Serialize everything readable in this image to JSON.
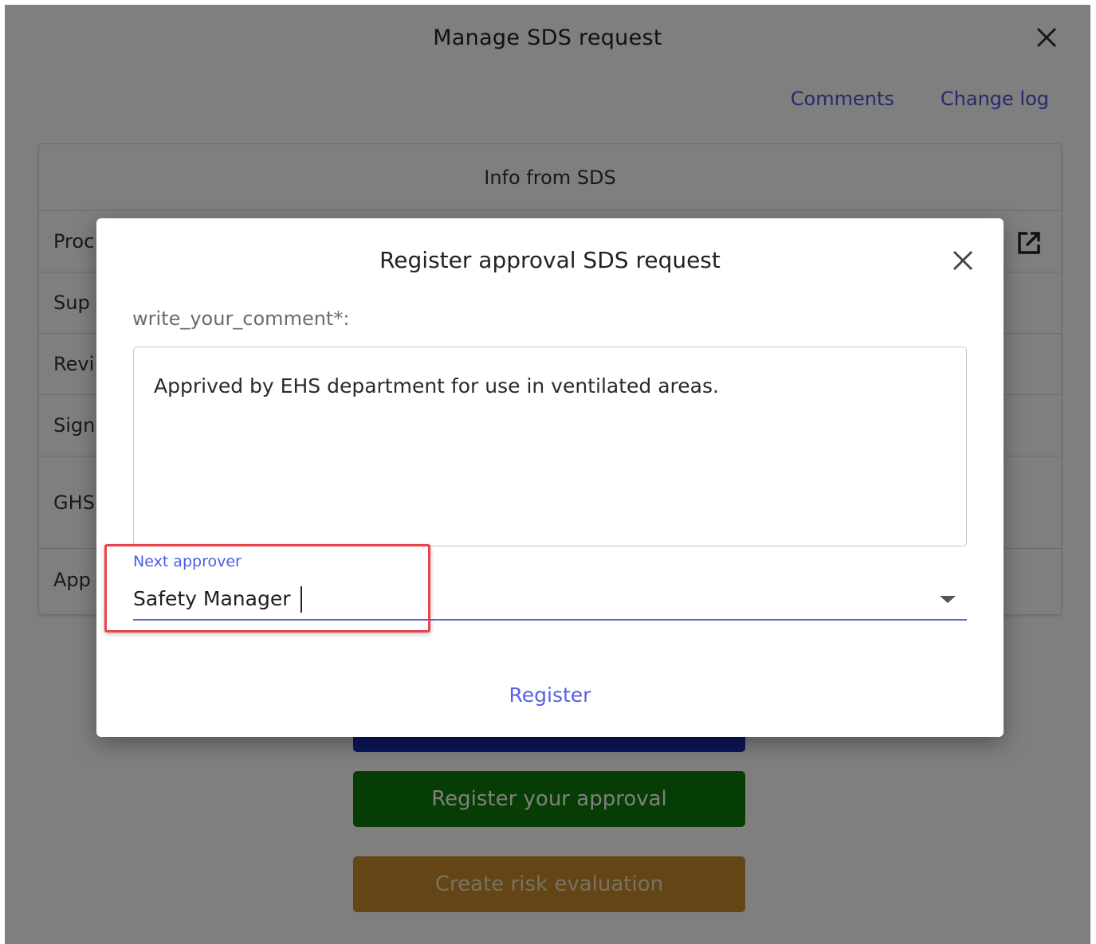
{
  "background": {
    "title": "Manage SDS request",
    "links": {
      "comments": "Comments",
      "change_log": "Change log"
    },
    "info_card": {
      "heading": "Info from SDS",
      "rows": [
        "Proc",
        "Sup",
        "Revi",
        "Sign",
        "GHS",
        "App"
      ]
    },
    "buttons": {
      "register_approval": "Register your approval",
      "create_risk": "Create risk evaluation"
    }
  },
  "modal": {
    "title": "Register approval SDS request",
    "comment_label": "write_your_comment*:",
    "comment_value": "Apprived by EHS department for use in ventilated areas.",
    "next_approver_label": "Next approver",
    "next_approver_value": "Safety Manager",
    "register_label": "Register"
  },
  "colors": {
    "link": "#4b53d6",
    "green_button": "#0a7a08",
    "brown_button": "#c98a2a",
    "blue_button": "#1b2bb3",
    "highlight": "#e8434a"
  }
}
